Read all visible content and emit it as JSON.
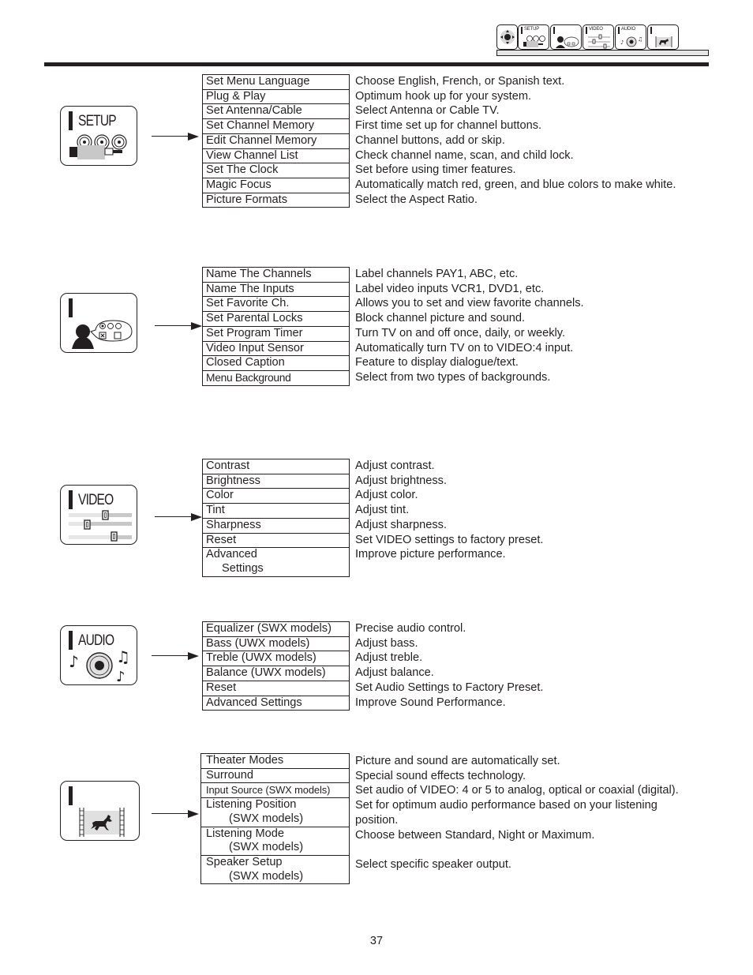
{
  "nav_strip": {
    "tabs": [
      {
        "name": "nav-tab-main",
        "label": "",
        "icon": "dpad-icon"
      },
      {
        "name": "nav-tab-setup",
        "label": "SETUP",
        "icon": "setup-connectors-icon"
      },
      {
        "name": "nav-tab-customize",
        "label": "",
        "icon": "person-speech-icon"
      },
      {
        "name": "nav-tab-video",
        "label": "VIDEO",
        "icon": "sliders-icon"
      },
      {
        "name": "nav-tab-audio",
        "label": "AUDIO",
        "icon": "speaker-music-icon"
      },
      {
        "name": "nav-tab-theater",
        "label": "",
        "icon": "film-horse-icon"
      }
    ]
  },
  "sections": [
    {
      "id": "setup",
      "icon_label": "SETUP",
      "icon": "setup-connectors-icon",
      "items": [
        {
          "label": "Set Menu Language",
          "desc": "Choose English, French, or Spanish text."
        },
        {
          "label": "Plug & Play",
          "desc": "Optimum hook up for your system."
        },
        {
          "label": "Set Antenna/Cable",
          "desc": "Select Antenna or Cable TV."
        },
        {
          "label": "Set Channel Memory",
          "desc": "First time set up for channel buttons."
        },
        {
          "label": "Edit Channel Memory",
          "desc": "Channel buttons, add or skip."
        },
        {
          "label": "View Channel List",
          "desc": "Check channel name, scan, and child lock."
        },
        {
          "label": "Set The Clock",
          "desc": "Set before using timer features."
        },
        {
          "label": "Magic Focus",
          "desc": "Automatically match red, green, and blue colors to make white."
        },
        {
          "label": "Picture Formats",
          "desc": "Select  the Aspect Ratio."
        }
      ]
    },
    {
      "id": "customize",
      "icon_label": "",
      "icon": "person-speech-icon",
      "items": [
        {
          "label": "Name The Channels",
          "desc": "Label channels PAY1, ABC, etc."
        },
        {
          "label": "Name The Inputs",
          "desc": "Label video inputs VCR1, DVD1, etc."
        },
        {
          "label": "Set Favorite Ch.",
          "desc": "Allows you to set and view favorite channels."
        },
        {
          "label": "Set Parental Locks",
          "desc": "Block channel picture and sound."
        },
        {
          "label": "Set Program Timer",
          "desc": "Turn TV on and off once, daily, or weekly."
        },
        {
          "label": "Video Input Sensor",
          "desc": "Automatically turn TV on to VIDEO:4 input."
        },
        {
          "label": "Closed Caption",
          "desc": "Feature to display dialogue/text."
        },
        {
          "label": "Menu Background",
          "desc": "Select from two types of backgrounds."
        }
      ]
    },
    {
      "id": "video",
      "icon_label": "VIDEO",
      "icon": "sliders-icon",
      "items": [
        {
          "label": "Contrast",
          "desc": "Adjust contrast."
        },
        {
          "label": "Brightness",
          "desc": "Adjust brightness."
        },
        {
          "label": "Color",
          "desc": "Adjust color."
        },
        {
          "label": "Tint",
          "desc": "Adjust tint."
        },
        {
          "label": "Sharpness",
          "desc": "Adjust sharpness."
        },
        {
          "label": "Reset",
          "desc": "Set VIDEO settings to factory preset."
        },
        {
          "label": "Advanced",
          "sub": "Settings",
          "desc": "Improve picture performance."
        }
      ]
    },
    {
      "id": "audio",
      "icon_label": "AUDIO",
      "icon": "speaker-music-icon",
      "items": [
        {
          "label": "Equalizer (SWX models)",
          "desc": "Precise audio control."
        },
        {
          "label": "Bass (UWX models)",
          "desc": "Adjust bass."
        },
        {
          "label": "Treble (UWX models)",
          "desc": "Adjust treble."
        },
        {
          "label": "Balance (UWX models)",
          "desc": "Adjust balance."
        },
        {
          "label": "Reset",
          "desc": "Set Audio Settings to Factory Preset."
        },
        {
          "label": "Advanced Settings",
          "desc": "Improve Sound Performance."
        }
      ]
    },
    {
      "id": "theater",
      "icon_label": "",
      "icon": "film-horse-icon",
      "items": [
        {
          "label": "Theater Modes",
          "desc": "Picture and sound are automatically set."
        },
        {
          "label": "Surround",
          "desc": "Special sound effects technology."
        },
        {
          "label": "Input Source (SWX models)",
          "desc": "Set audio of VIDEO: 4 or 5 to analog, optical or coaxial (digital)."
        },
        {
          "label": "Listening Position",
          "sub": "(SWX models)",
          "desc": "Set for optimum audio performance based on your listening",
          "desc2": "position."
        },
        {
          "label": "Listening Mode",
          "sub": "(SWX models)",
          "desc": "Choose between Standard, Night or Maximum.",
          "desc2": ""
        },
        {
          "label": "Speaker Setup",
          "sub": "(SWX models)",
          "desc": "Select specific speaker output.",
          "desc2": ""
        }
      ]
    }
  ],
  "page_number": "37"
}
